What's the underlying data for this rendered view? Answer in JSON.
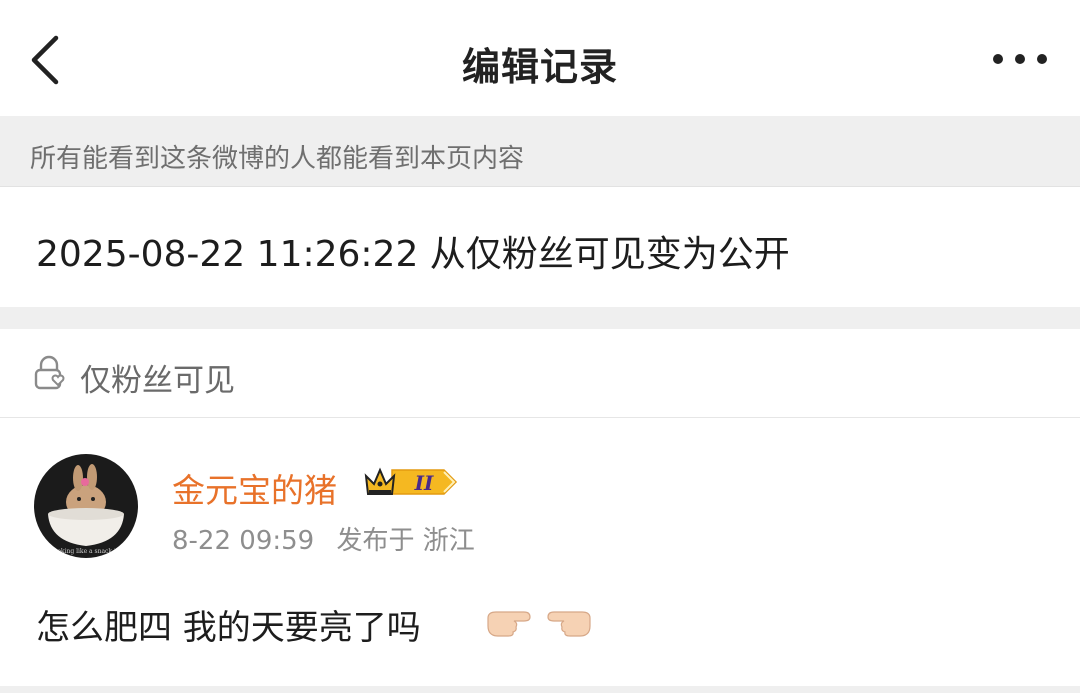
{
  "nav": {
    "title": "编辑记录",
    "back_icon": "chevron-left-icon",
    "more_icon": "more-dots-icon"
  },
  "notice": {
    "text": "所有能看到这条微博的人都能看到本页内容"
  },
  "record": {
    "text": "2025-08-22 11:26:22 从仅粉丝可见变为公开"
  },
  "visibility": {
    "icon": "lock-heart-icon",
    "label": "仅粉丝可见"
  },
  "post": {
    "author": {
      "name": "金元宝的猪",
      "avatar": "avatar-bunny-in-bowl",
      "avatar_caption": "looking like a snack th",
      "badge_icon": "crown-badge-icon",
      "badge_text": "II"
    },
    "time": "8-22 09:59",
    "location": "发布于 浙江",
    "text": "怎么肥四 我的天要亮了吗",
    "emojis": [
      "hand-pointing-right-icon",
      "hand-pointing-left-icon"
    ]
  },
  "colors": {
    "username": "#e8722a",
    "background_gray": "#efefef",
    "badge_gold": "#f5b821"
  }
}
